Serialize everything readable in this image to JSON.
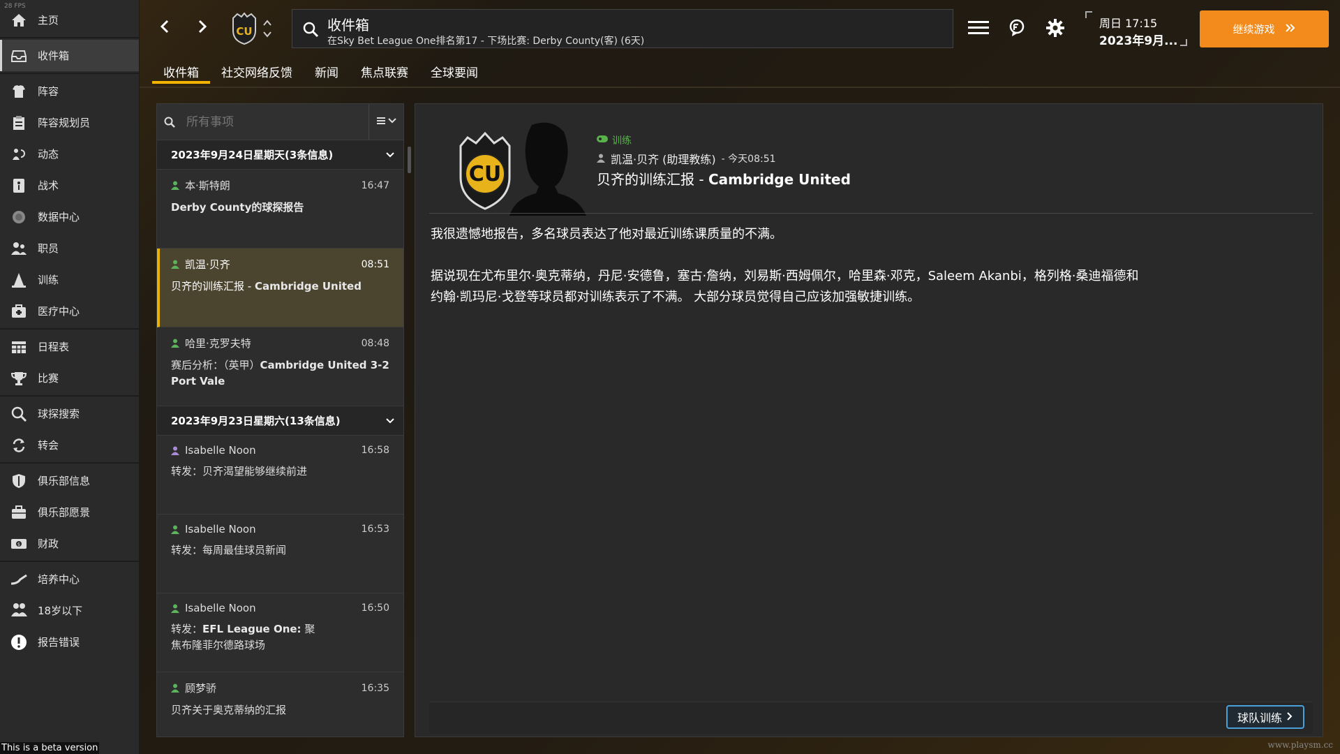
{
  "sidebar": {
    "fps": "28 FPS",
    "items": [
      {
        "label": "主页",
        "icon": "home-icon"
      },
      {
        "label": "收件箱",
        "icon": "inbox-icon",
        "active": true
      },
      {
        "label": "阵容",
        "icon": "squad-icon"
      },
      {
        "label": "阵容规划员",
        "icon": "clipboard-icon"
      },
      {
        "label": "动态",
        "icon": "dynamics-icon"
      },
      {
        "label": "战术",
        "icon": "tactics-icon"
      },
      {
        "label": "数据中心",
        "icon": "data-hub-icon"
      },
      {
        "label": "职员",
        "icon": "staff-icon"
      },
      {
        "label": "训练",
        "icon": "training-cone-icon"
      },
      {
        "label": "医疗中心",
        "icon": "medical-icon"
      },
      {
        "label": "日程表",
        "icon": "calendar-icon"
      },
      {
        "label": "比赛",
        "icon": "trophy-icon"
      },
      {
        "label": "球探搜索",
        "icon": "scouting-search-icon"
      },
      {
        "label": "转会",
        "icon": "transfer-icon"
      },
      {
        "label": "俱乐部信息",
        "icon": "shield-icon"
      },
      {
        "label": "俱乐部愿景",
        "icon": "briefcase-icon"
      },
      {
        "label": "财政",
        "icon": "finance-icon"
      },
      {
        "label": "培养中心",
        "icon": "development-icon"
      },
      {
        "label": "18岁以下",
        "icon": "u18-icon"
      },
      {
        "label": "报告错误",
        "icon": "alert-icon"
      }
    ],
    "beta_note": "This is a beta version"
  },
  "topbar": {
    "title": "收件箱",
    "subtitle": "在Sky Bet League One排名第17 - 下场比赛: Derby County(客) (6天)",
    "date_line1": "周日 17:15",
    "date_line2": "2023年9月...",
    "continue_label": "继续游戏"
  },
  "tabs": [
    "收件箱",
    "社交网络反馈",
    "新闻",
    "焦点联赛",
    "全球要闻"
  ],
  "inbox": {
    "filter_placeholder": "所有事项",
    "groups": [
      {
        "header": "2023年9月24日星期天(3条信息)",
        "messages": [
          {
            "sender": "本·斯特朗",
            "time": "16:47",
            "subject_bold": "Derby County的球探报告",
            "subject_rest": "",
            "person_color": "#5cb35c"
          },
          {
            "sender": "凯温·贝齐",
            "time": "08:51",
            "subject_rest": "贝齐的训练汇报 - ",
            "subject_bold": "Cambridge United",
            "person_color": "#5cb35c",
            "selected": true
          },
          {
            "sender": "哈里·克罗夫特",
            "time": "08:48",
            "subject_rest": "赛后分析：（英甲）",
            "subject_bold": "Cambridge United 3-2 Port Vale",
            "person_color": "#5cb35c"
          }
        ]
      },
      {
        "header": "2023年9月23日星期六(13条信息)",
        "messages": [
          {
            "sender": "Isabelle Noon",
            "time": "16:58",
            "subject_rest": "转发：贝齐渴望能够继续前进",
            "subject_bold": "",
            "person_color": "#a98bd8"
          },
          {
            "sender": "Isabelle Noon",
            "time": "16:53",
            "subject_rest": "转发：每周最佳球员新闻",
            "subject_bold": "",
            "person_color": "#5cb35c"
          },
          {
            "sender": "Isabelle Noon",
            "time": "16:50",
            "subject_rest": "转发：",
            "subject_bold": "EFL League One:",
            "subject_tail": "聚焦布隆菲尔德路球场",
            "person_color": "#5cb35c"
          },
          {
            "sender": "顾梦骄",
            "time": "16:35",
            "subject_rest": "贝齐关于奥克蒂纳的汇报",
            "subject_bold": "",
            "person_color": "#5cb35c"
          }
        ]
      }
    ]
  },
  "message": {
    "category": "训练",
    "from": "凯温·贝齐 (助理教练)",
    "time": "- 今天08:51",
    "title_rest": "贝齐的训练汇报 - ",
    "title_bold": "Cambridge United",
    "para1": "我很遗憾地报告，多名球员表达了他对最近训练课质量的不满。",
    "para2_line1": "据说现在尤布里尔·奥克蒂纳，丹尼·安德鲁，塞古·詹纳，刘易斯·西姆佩尔，哈里森·邓克，Saleem Akanbi，格列格·桑迪福德和",
    "para2_line2": "约翰·凯玛尼·戈登等球员都对训练表示了不满。 大部分球员觉得自己应该加强敏捷训练。",
    "action_button": "球队训练",
    "crest_text": "CU"
  },
  "watermark": "www.playsm.cc",
  "colors": {
    "accent_orange": "#f28a1c",
    "tab_underline": "#f2b400",
    "training_green": "#58b44a",
    "selected_bg": "#4b4530"
  }
}
